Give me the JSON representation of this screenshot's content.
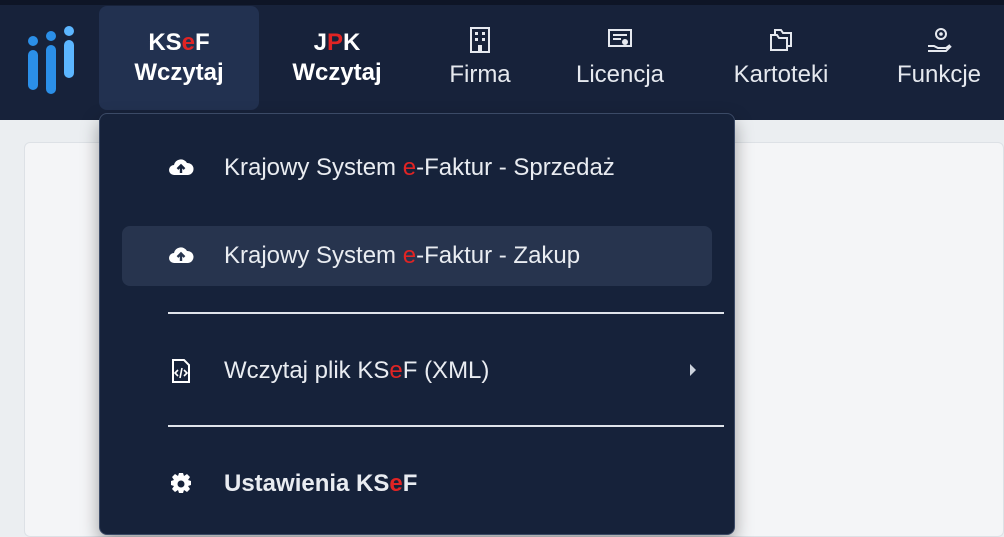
{
  "colors": {
    "topbar": "#17223a",
    "accent_red": "#e02424",
    "menu_bg": "#16223a",
    "menu_highlight": "#27344e"
  },
  "nav": {
    "ksef": {
      "line1_a": "KS",
      "line1_red": "e",
      "line1_b": "F",
      "line2": "Wczytaj"
    },
    "jpk": {
      "line1_a": "J",
      "line1_red": "P",
      "line1_b": "K",
      "line2": "Wczytaj"
    },
    "firma": {
      "label": "Firma",
      "icon": "building-icon"
    },
    "licencja": {
      "label": "Licencja",
      "icon": "certificate-icon"
    },
    "kartoteki": {
      "label": "Kartoteki",
      "icon": "folders-icon"
    },
    "funkcje": {
      "label": "Funkcje",
      "icon": "hand-gear-icon"
    }
  },
  "menu": {
    "sprzedaz": {
      "icon": "cloud-upload-icon",
      "a": "Krajowy System ",
      "red": "e",
      "b": "-Faktur - Sprzedaż"
    },
    "zakup": {
      "icon": "cloud-upload-icon",
      "a": "Krajowy System ",
      "red": "e",
      "b": "-Faktur - Zakup"
    },
    "plik": {
      "icon": "xml-file-icon",
      "a": "Wczytaj plik KS",
      "red": "e",
      "b": "F (XML)"
    },
    "ustawienia": {
      "icon": "gear-icon",
      "a": "Ustawienia KS",
      "red": "e",
      "b": "F"
    }
  }
}
